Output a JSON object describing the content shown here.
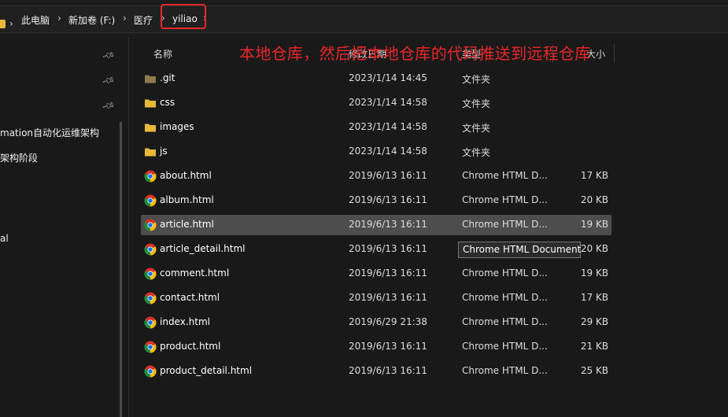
{
  "address_bar": {
    "crumbs": [
      "此电脑",
      "新加卷 (F:)",
      "医疗",
      "yiliao"
    ],
    "chevron": "›"
  },
  "annotation": "本地仓库，然后把本地仓库的代码推送到远程仓库",
  "sidebar": {
    "items": [
      {
        "label": "mation自动化运维架构"
      },
      {
        "label": "架构阶段"
      },
      {
        "label": "al"
      }
    ]
  },
  "columns": {
    "name": "名称",
    "date": "修改日期",
    "type": "类型",
    "size": "大小"
  },
  "files": [
    {
      "name": ".git",
      "date": "2023/1/14 14:45",
      "type": "文件夹",
      "size": "",
      "icon": "folder-icon"
    },
    {
      "name": "css",
      "date": "2023/1/14 14:58",
      "type": "文件夹",
      "size": "",
      "icon": "folder-icon"
    },
    {
      "name": "images",
      "date": "2023/1/14 14:58",
      "type": "文件夹",
      "size": "",
      "icon": "folder-icon"
    },
    {
      "name": "js",
      "date": "2023/1/14 14:58",
      "type": "文件夹",
      "size": "",
      "icon": "folder-icon"
    },
    {
      "name": "about.html",
      "date": "2019/6/13 16:11",
      "type": "Chrome HTML D...",
      "size": "17 KB",
      "icon": "chrome-icon"
    },
    {
      "name": "album.html",
      "date": "2019/6/13 16:11",
      "type": "Chrome HTML D...",
      "size": "20 KB",
      "icon": "chrome-icon"
    },
    {
      "name": "article.html",
      "date": "2019/6/13 16:11",
      "type": "Chrome HTML D...",
      "size": "19 KB",
      "icon": "chrome-icon"
    },
    {
      "name": "article_detail.html",
      "date": "2019/6/13 16:11",
      "type": "Chrome HTML D...",
      "size": "20 KB",
      "icon": "chrome-icon"
    },
    {
      "name": "comment.html",
      "date": "2019/6/13 16:11",
      "type": "Chrome HTML D...",
      "size": "19 KB",
      "icon": "chrome-icon"
    },
    {
      "name": "contact.html",
      "date": "2019/6/13 16:11",
      "type": "Chrome HTML D...",
      "size": "17 KB",
      "icon": "chrome-icon"
    },
    {
      "name": "index.html",
      "date": "2019/6/29 21:38",
      "type": "Chrome HTML D...",
      "size": "29 KB",
      "icon": "chrome-icon"
    },
    {
      "name": "product.html",
      "date": "2019/6/13 16:11",
      "type": "Chrome HTML D...",
      "size": "21 KB",
      "icon": "chrome-icon"
    },
    {
      "name": "product_detail.html",
      "date": "2019/6/13 16:11",
      "type": "Chrome HTML D...",
      "size": "25 KB",
      "icon": "chrome-icon"
    }
  ],
  "selected_file": "article.html",
  "tooltip": "Chrome HTML Document",
  "colors": {
    "annotation": "#e8262a",
    "folder": "#e8b83a",
    "git_folder": "#8f7a4d",
    "selection": "#4d4d4d",
    "background": "#191919"
  }
}
